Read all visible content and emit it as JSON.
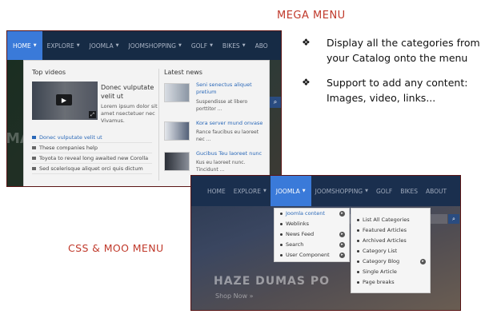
{
  "labels": {
    "mega_menu": "MEGA MENU",
    "css_moo_menu": "CSS & MOO MENU"
  },
  "features": [
    {
      "bullet": "❖",
      "text": "Display all the categories from your Catalog onto the menu"
    },
    {
      "bullet": "❖",
      "text": "Support to add any content: Images, video, links..."
    }
  ],
  "mega": {
    "nav": [
      {
        "label": "HOME",
        "caret": true,
        "active": true
      },
      {
        "label": "EXPLORE",
        "caret": true
      },
      {
        "label": "JOOMLA",
        "caret": true
      },
      {
        "label": "JOOMSHOPPING",
        "caret": true
      },
      {
        "label": "GOLF",
        "caret": true
      },
      {
        "label": "BIKES",
        "caret": true
      },
      {
        "label": "ABO",
        "caret": false
      }
    ],
    "bg_text": "MA",
    "search_icon": "search-icon",
    "top_videos": {
      "heading": "Top videos",
      "featured_title": "Donec vulputate velit ut",
      "featured_desc": "Lorem ipsum dolor sit amet nsectetuer nec Vivamus.",
      "list": [
        "Donec vulputate velit ut",
        "These companies help",
        "Toyota to reveal long awaited new Corolla",
        "Sed scelerisque aliquet orci quis dictum"
      ]
    },
    "latest_news": {
      "heading": "Latest news",
      "items": [
        {
          "title": "Seni senectus aliquet pretium",
          "desc": "Suspendisse at libero porttitor ..."
        },
        {
          "title": "Kora server mund onvase",
          "desc": "Rance faucibus eu laoreet nec ..."
        },
        {
          "title": "Gucibus Teu laoreet nunc",
          "desc": "Kus eu laoreet nunc. Tincidunt ..."
        }
      ]
    }
  },
  "moo": {
    "nav": [
      {
        "label": "HOME",
        "caret": false
      },
      {
        "label": "EXPLORE",
        "caret": true
      },
      {
        "label": "JOOMLA",
        "caret": true,
        "active": true
      },
      {
        "label": "JOOMSHOPPING",
        "caret": true
      },
      {
        "label": "GOLF",
        "caret": false
      },
      {
        "label": "BIKES",
        "caret": false
      },
      {
        "label": "ABOUT",
        "caret": false
      }
    ],
    "hero_title": "HAZE DUMAS PO",
    "hero_sub": "Shop Now »",
    "submenu1": [
      {
        "label": "Joomla content",
        "arrow": true,
        "highlight": true
      },
      {
        "label": "Weblinks",
        "arrow": false
      },
      {
        "label": "News Feed",
        "arrow": true
      },
      {
        "label": "Search",
        "arrow": true
      },
      {
        "label": "User Component",
        "arrow": true
      }
    ],
    "submenu2": [
      {
        "label": "List All Categories",
        "arrow": false
      },
      {
        "label": "Featured Articles",
        "arrow": false
      },
      {
        "label": "Archived Articles",
        "arrow": false
      },
      {
        "label": "Category List",
        "arrow": false
      },
      {
        "label": "Category Blog",
        "arrow": true
      },
      {
        "label": "Single Article",
        "arrow": false
      },
      {
        "label": "Page breaks",
        "arrow": false
      }
    ]
  }
}
